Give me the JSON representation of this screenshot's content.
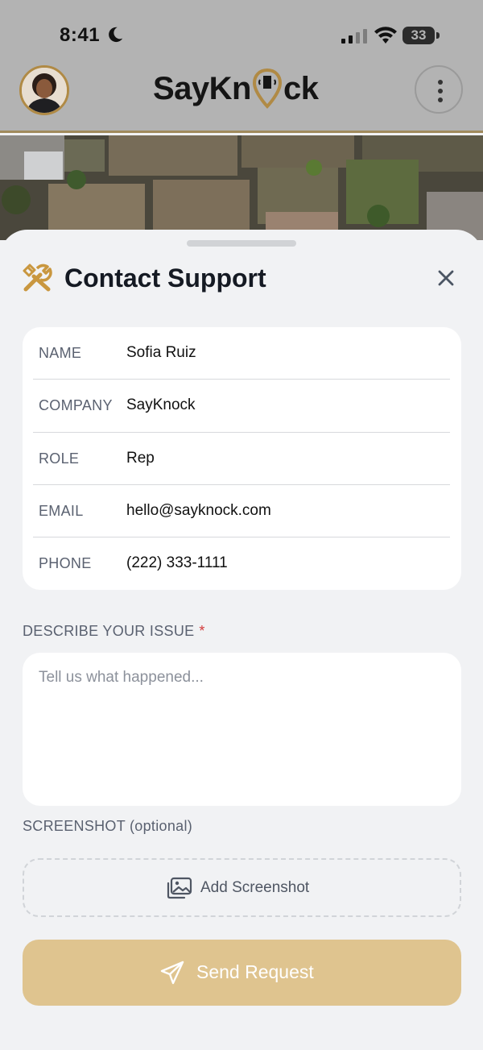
{
  "status_bar": {
    "time": "8:41",
    "battery": "33"
  },
  "header": {
    "logo_text_left": "SayKn",
    "logo_text_right": "ck"
  },
  "sheet": {
    "title": "Contact Support",
    "info": [
      {
        "label": "NAME",
        "value": "Sofia Ruiz"
      },
      {
        "label": "COMPANY",
        "value": "SayKnock"
      },
      {
        "label": "ROLE",
        "value": "Rep"
      },
      {
        "label": "EMAIL",
        "value": "hello@sayknock.com"
      },
      {
        "label": "PHONE",
        "value": "(222) 333-1111"
      }
    ],
    "issue_label": "DESCRIBE YOUR ISSUE",
    "issue_required_mark": "*",
    "issue_placeholder": "Tell us what happened...",
    "issue_value": "",
    "screenshot_label": "SCREENSHOT (optional)",
    "add_screenshot_label": "Add Screenshot",
    "send_label": "Send Request"
  },
  "colors": {
    "accent_gold": "#b08a45",
    "send_button_bg": "#dfc48f",
    "required": "#d33b3b"
  }
}
